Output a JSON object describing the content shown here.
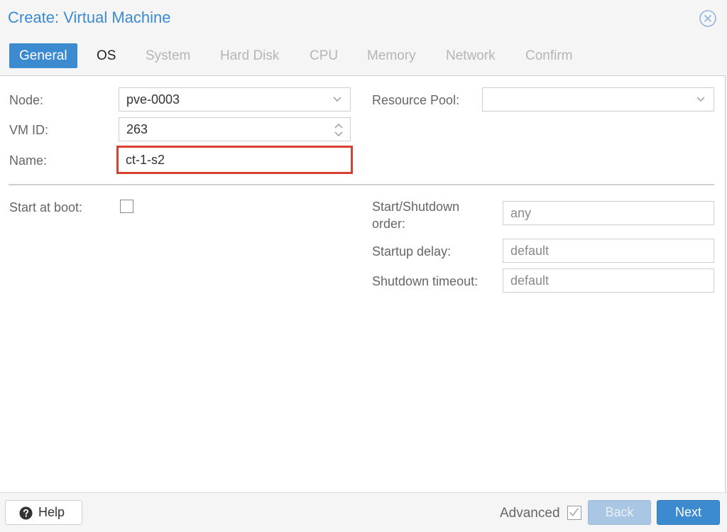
{
  "window": {
    "title": "Create: Virtual Machine"
  },
  "tabs": [
    {
      "label": "General",
      "state": "active"
    },
    {
      "label": "OS",
      "state": "enabled"
    },
    {
      "label": "System",
      "state": "disabled"
    },
    {
      "label": "Hard Disk",
      "state": "disabled"
    },
    {
      "label": "CPU",
      "state": "disabled"
    },
    {
      "label": "Memory",
      "state": "disabled"
    },
    {
      "label": "Network",
      "state": "disabled"
    },
    {
      "label": "Confirm",
      "state": "disabled"
    }
  ],
  "form": {
    "node": {
      "label": "Node:",
      "value": "pve-0003"
    },
    "vmid": {
      "label": "VM ID:",
      "value": "263"
    },
    "name": {
      "label": "Name:",
      "value": "ct-1-s2"
    },
    "resource_pool": {
      "label": "Resource Pool:",
      "value": ""
    },
    "start_at_boot": {
      "label": "Start at boot:",
      "checked": false
    },
    "start_shutdown_order": {
      "label_line1": "Start/Shutdown",
      "label_line2": "order:",
      "placeholder": "any"
    },
    "startup_delay": {
      "label": "Startup delay:",
      "placeholder": "default"
    },
    "shutdown_timeout": {
      "label": "Shutdown timeout:",
      "placeholder": "default"
    }
  },
  "footer": {
    "help_label": "Help",
    "advanced_label": "Advanced",
    "advanced_checked": true,
    "back_label": "Back",
    "next_label": "Next"
  },
  "colors": {
    "accent": "#3c8ad0",
    "highlight_border": "#d8402f",
    "disabled_button": "#a9c6e4"
  }
}
